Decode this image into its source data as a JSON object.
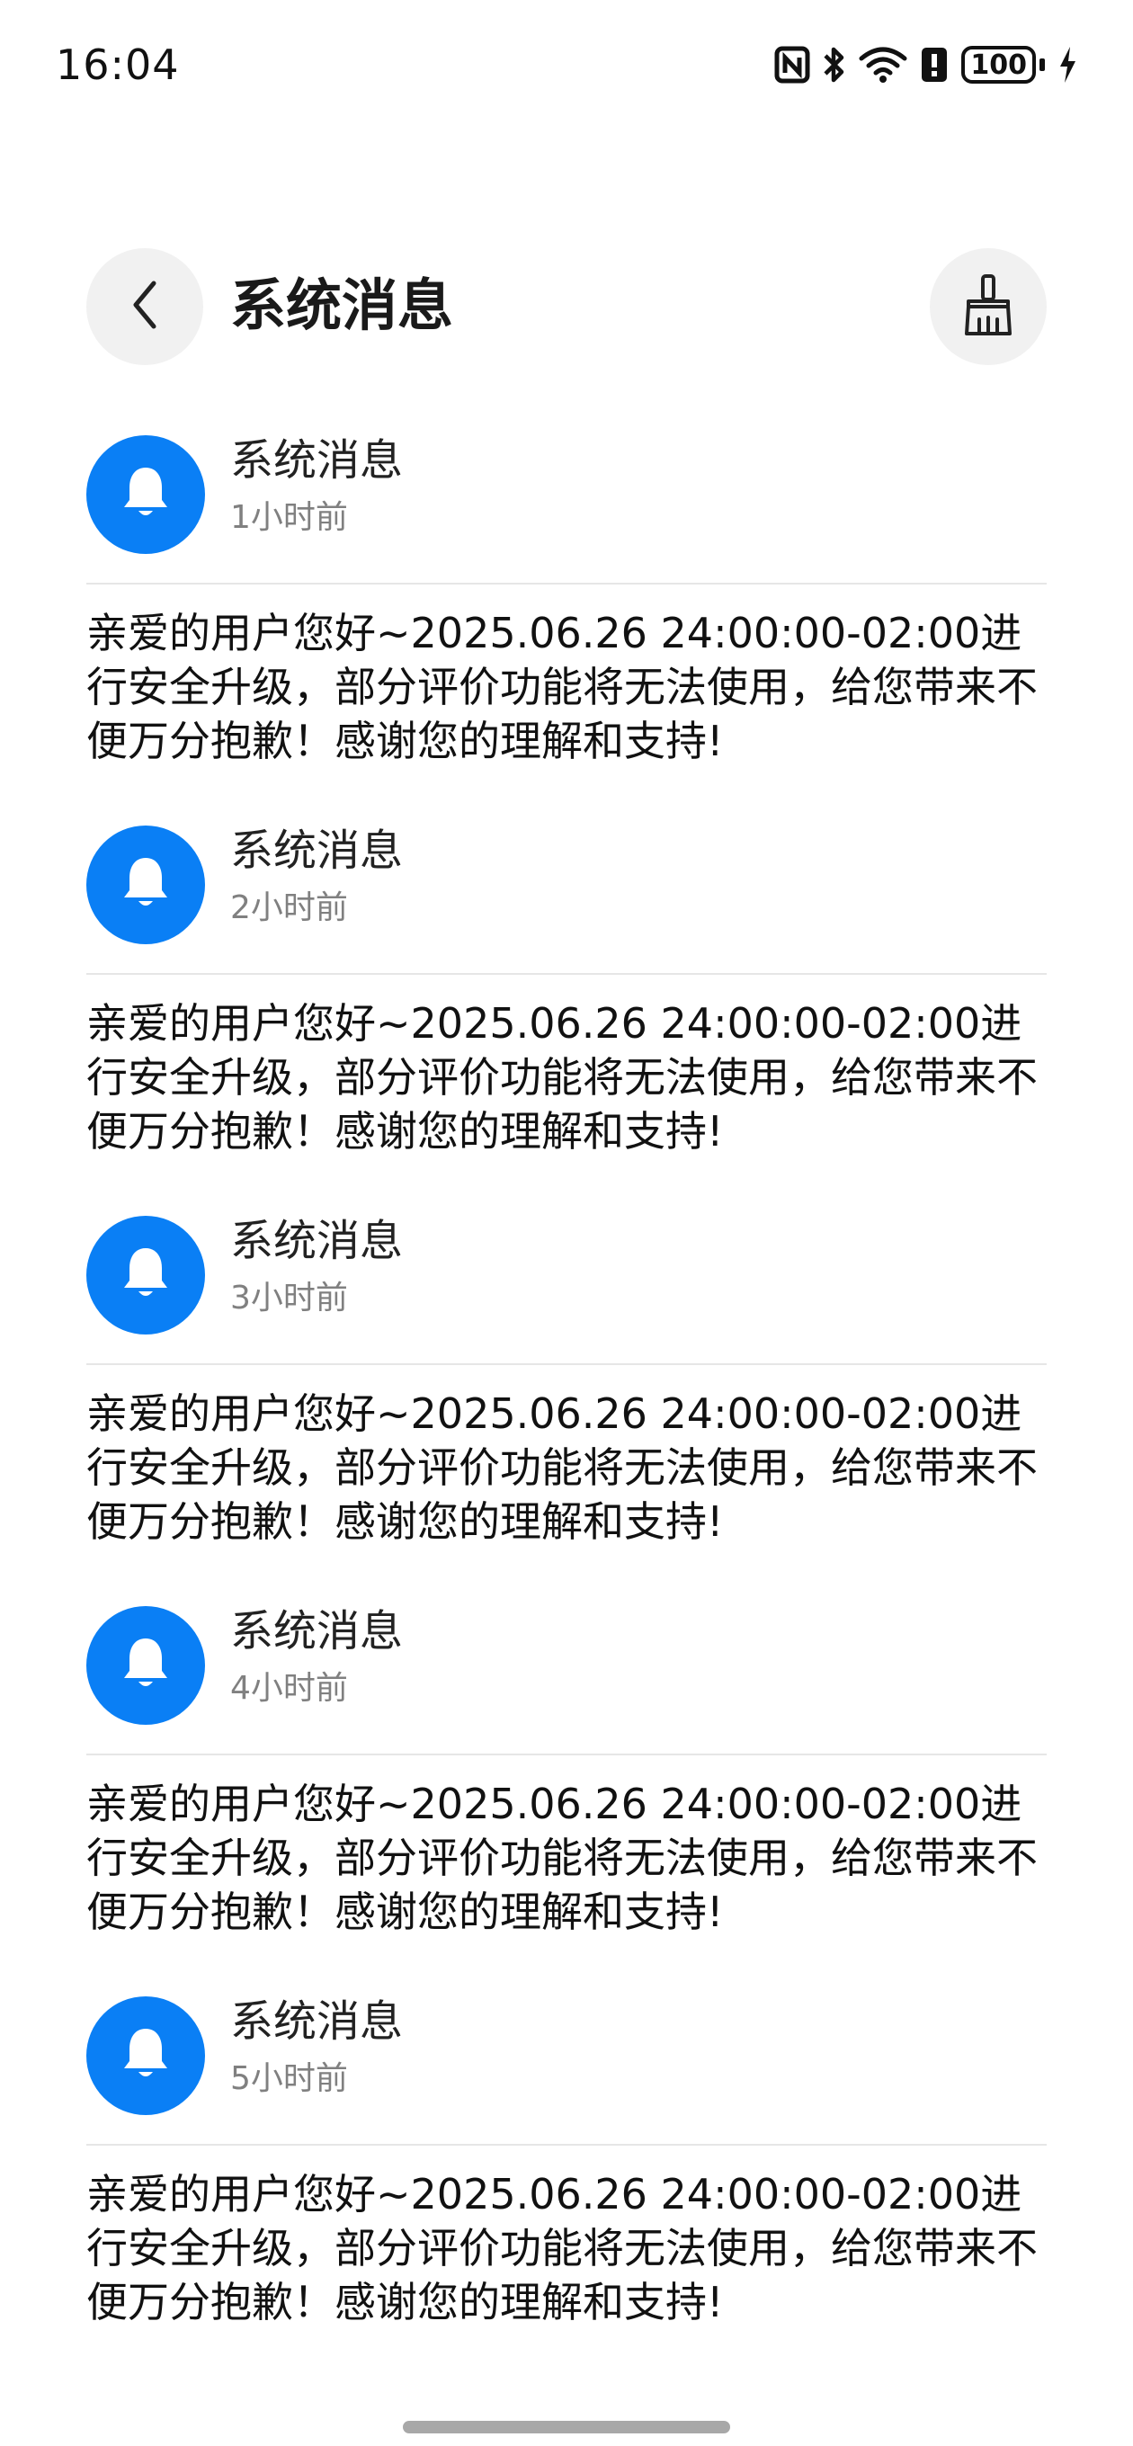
{
  "status_bar": {
    "time": "16:04",
    "battery": "100",
    "icons": [
      "nfc-icon",
      "bluetooth-icon",
      "wifi-icon",
      "alert-icon",
      "battery-icon",
      "charging-icon"
    ]
  },
  "header": {
    "title": "系统消息",
    "back_icon": "chevron-left-icon",
    "clean_icon": "broom-icon"
  },
  "messages": [
    {
      "title": "系统消息",
      "time": "1小时前",
      "body": "亲爱的用户您好~2025.06.26 24:00:00-02:00进行安全升级，部分评价功能将无法使用，给您带来不便万分抱歉！感谢您的理解和支持!"
    },
    {
      "title": "系统消息",
      "time": "2小时前",
      "body": "亲爱的用户您好~2025.06.26 24:00:00-02:00进行安全升级，部分评价功能将无法使用，给您带来不便万分抱歉！感谢您的理解和支持!"
    },
    {
      "title": "系统消息",
      "time": "3小时前",
      "body": "亲爱的用户您好~2025.06.26 24:00:00-02:00进行安全升级，部分评价功能将无法使用，给您带来不便万分抱歉！感谢您的理解和支持!"
    },
    {
      "title": "系统消息",
      "time": "4小时前",
      "body": "亲爱的用户您好~2025.06.26 24:00:00-02:00进行安全升级，部分评价功能将无法使用，给您带来不便万分抱歉！感谢您的理解和支持!"
    },
    {
      "title": "系统消息",
      "time": "5小时前",
      "body": "亲爱的用户您好~2025.06.26 24:00:00-02:00进行安全升级，部分评价功能将无法使用，给您带来不便万分抱歉！感谢您的理解和支持!"
    }
  ],
  "colors": {
    "accent": "#0a7ff5",
    "muted_text": "#808080",
    "button_bg": "#f1f1f1"
  }
}
